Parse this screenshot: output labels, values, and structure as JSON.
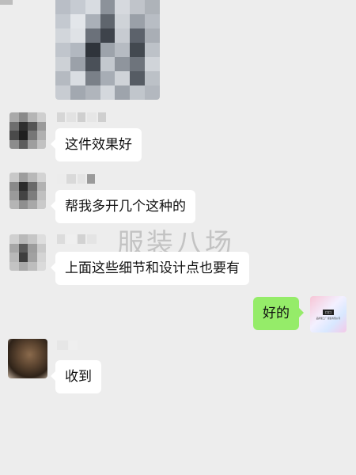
{
  "colors": {
    "background": "#ededed",
    "bubble_received": "#ffffff",
    "bubble_sent": "#95ec69"
  },
  "messages": [
    {
      "side": "left",
      "text": "这件效果好"
    },
    {
      "side": "left",
      "text": "帮我多开几个这种的"
    },
    {
      "side": "left",
      "text": "上面这些细节和设计点也要有"
    },
    {
      "side": "right",
      "text": "好的"
    },
    {
      "side": "left",
      "text": "收到"
    }
  ],
  "watermark": "服装八场",
  "self_avatar": {
    "logo_text": "口口",
    "sub_text": "品牌服工厂 服装有限公司"
  }
}
